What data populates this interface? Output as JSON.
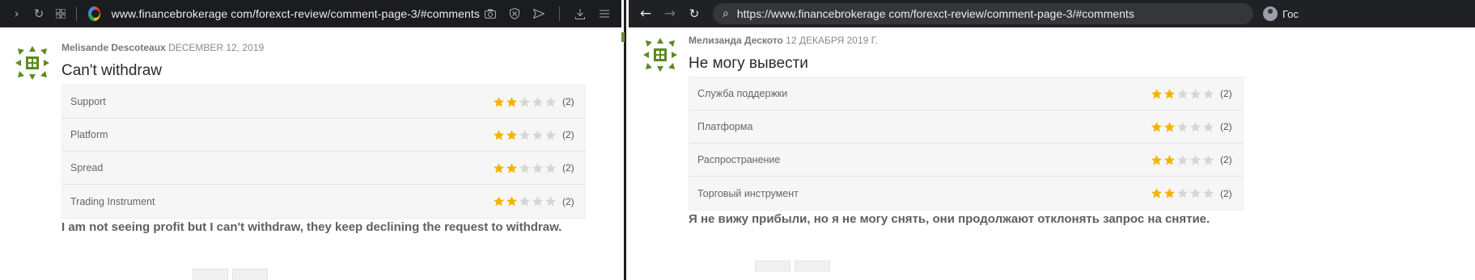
{
  "left": {
    "url": "www.financebrokerage com/forexct-review/comment-page-3/#comments",
    "comment": {
      "author": "Melisande Descoteaux",
      "date": "DECEMBER 12, 2019",
      "title": "Can't withdraw",
      "ratings": [
        {
          "label": "Support",
          "stars": 2,
          "count": "(2)"
        },
        {
          "label": "Platform",
          "stars": 2,
          "count": "(2)"
        },
        {
          "label": "Spread",
          "stars": 2,
          "count": "(2)"
        },
        {
          "label": "Trading Instrument",
          "stars": 2,
          "count": "(2)"
        }
      ],
      "body": "I am not seeing profit but I can't withdraw, they keep declining the request to withdraw."
    }
  },
  "right": {
    "url": "https://www.financebrokerage com/forexct-review/comment-page-3/#comments",
    "profile_label": "Гос",
    "comment": {
      "author": "Мелизанда Деското",
      "date": "12 ДЕКАБРЯ 2019 Г.",
      "title": "Не могу вывести",
      "ratings": [
        {
          "label": "Служба поддержки",
          "stars": 2,
          "count": "(2)"
        },
        {
          "label": "Платформа",
          "stars": 2,
          "count": "(2)"
        },
        {
          "label": "Распространение",
          "stars": 2,
          "count": "(2)"
        },
        {
          "label": "Торговый инструмент",
          "stars": 2,
          "count": "(2)"
        }
      ],
      "body": "Я не вижу прибыли, но я не могу снять, они продолжают отклонять запрос на снятие."
    }
  },
  "colors": {
    "star_filled": "#f5b301",
    "star_empty": "#d6d6d6",
    "avatar_green": "#5c8a1f"
  },
  "icons": {
    "left_toolbar": [
      "chevron-right-icon",
      "reload-icon",
      "tab-grid-icon",
      "google-icon",
      "camera-icon",
      "shield-icon",
      "send-icon",
      "download-icon",
      "menu-icon"
    ],
    "right_toolbar": [
      "back-arrow-icon",
      "forward-arrow-icon",
      "reload-icon",
      "search-icon",
      "profile-icon"
    ]
  }
}
